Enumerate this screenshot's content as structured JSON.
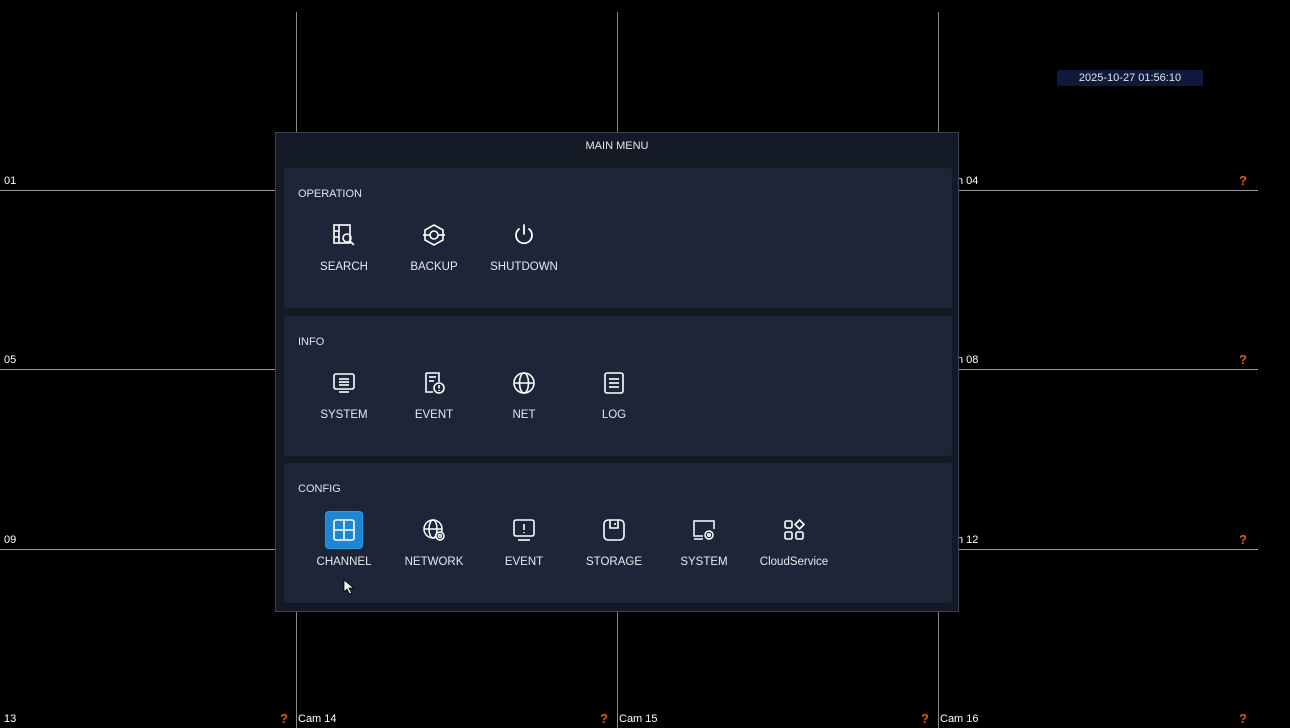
{
  "datetime": "2025-10-27 01:56:10",
  "cameras": {
    "r1c1": "01",
    "r1c4": "n 04",
    "r2c1": "05",
    "r2c4": "n 08",
    "r3c1": "09",
    "r3c4": "n 12",
    "r4c1": "13",
    "r4c2": "Cam 14",
    "r4c3": "Cam 15",
    "r4c4": "Cam 16",
    "status": "?"
  },
  "menu": {
    "title": "MAIN MENU",
    "operation": {
      "title": "OPERATION",
      "items": [
        {
          "label": "SEARCH",
          "icon": "search-icon"
        },
        {
          "label": "BACKUP",
          "icon": "backup-icon"
        },
        {
          "label": "SHUTDOWN",
          "icon": "power-icon"
        }
      ]
    },
    "info": {
      "title": "INFO",
      "items": [
        {
          "label": "SYSTEM",
          "icon": "system-info-icon"
        },
        {
          "label": "EVENT",
          "icon": "event-info-icon"
        },
        {
          "label": "NET",
          "icon": "globe-icon"
        },
        {
          "label": "LOG",
          "icon": "log-icon"
        }
      ]
    },
    "config": {
      "title": "CONFIG",
      "items": [
        {
          "label": "CHANNEL",
          "icon": "channel-grid-icon",
          "selected": true
        },
        {
          "label": "NETWORK",
          "icon": "network-settings-icon"
        },
        {
          "label": "EVENT",
          "icon": "event-alert-icon"
        },
        {
          "label": "STORAGE",
          "icon": "storage-icon"
        },
        {
          "label": "SYSTEM",
          "icon": "system-settings-icon"
        },
        {
          "label": "CloudService",
          "icon": "cloud-service-icon"
        }
      ]
    }
  },
  "colors": {
    "selected": "#1f86d4",
    "status": "#e05a14",
    "panel": "#1c2638"
  }
}
